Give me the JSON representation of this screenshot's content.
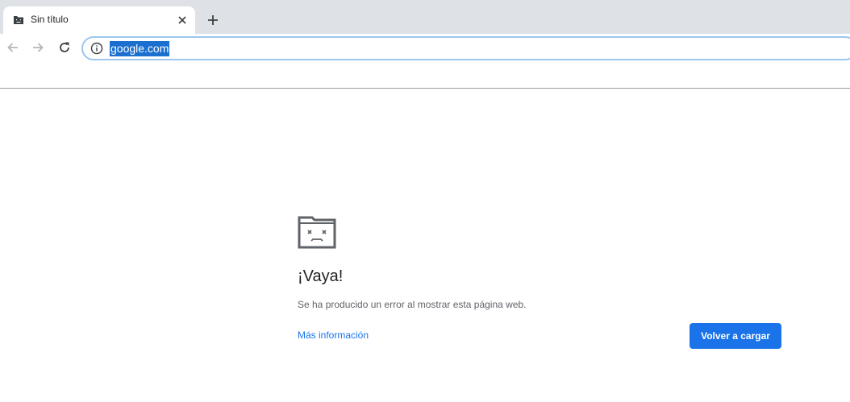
{
  "browser": {
    "tab": {
      "title": "Sin título",
      "favicon": "sad-folder-icon"
    },
    "icons": {
      "close": "close-icon",
      "new_tab": "plus-icon",
      "back": "back-arrow-icon",
      "forward": "forward-arrow-icon",
      "reload": "reload-icon",
      "site_info": "info-icon"
    },
    "omnibox": {
      "url": "google.com",
      "url_selected": true
    }
  },
  "error_page": {
    "icon": "sad-tab-icon",
    "heading": "¡Vaya!",
    "message": "Se ha producido un error al mostrar esta página web.",
    "more_info_link": "Más información",
    "reload_button": "Volver a cargar"
  },
  "colors": {
    "tabstrip": "#dee1e6",
    "accent": "#1a73e8",
    "selection": "#1a6fcf",
    "omnibox_focus": "#9ec6ee"
  }
}
